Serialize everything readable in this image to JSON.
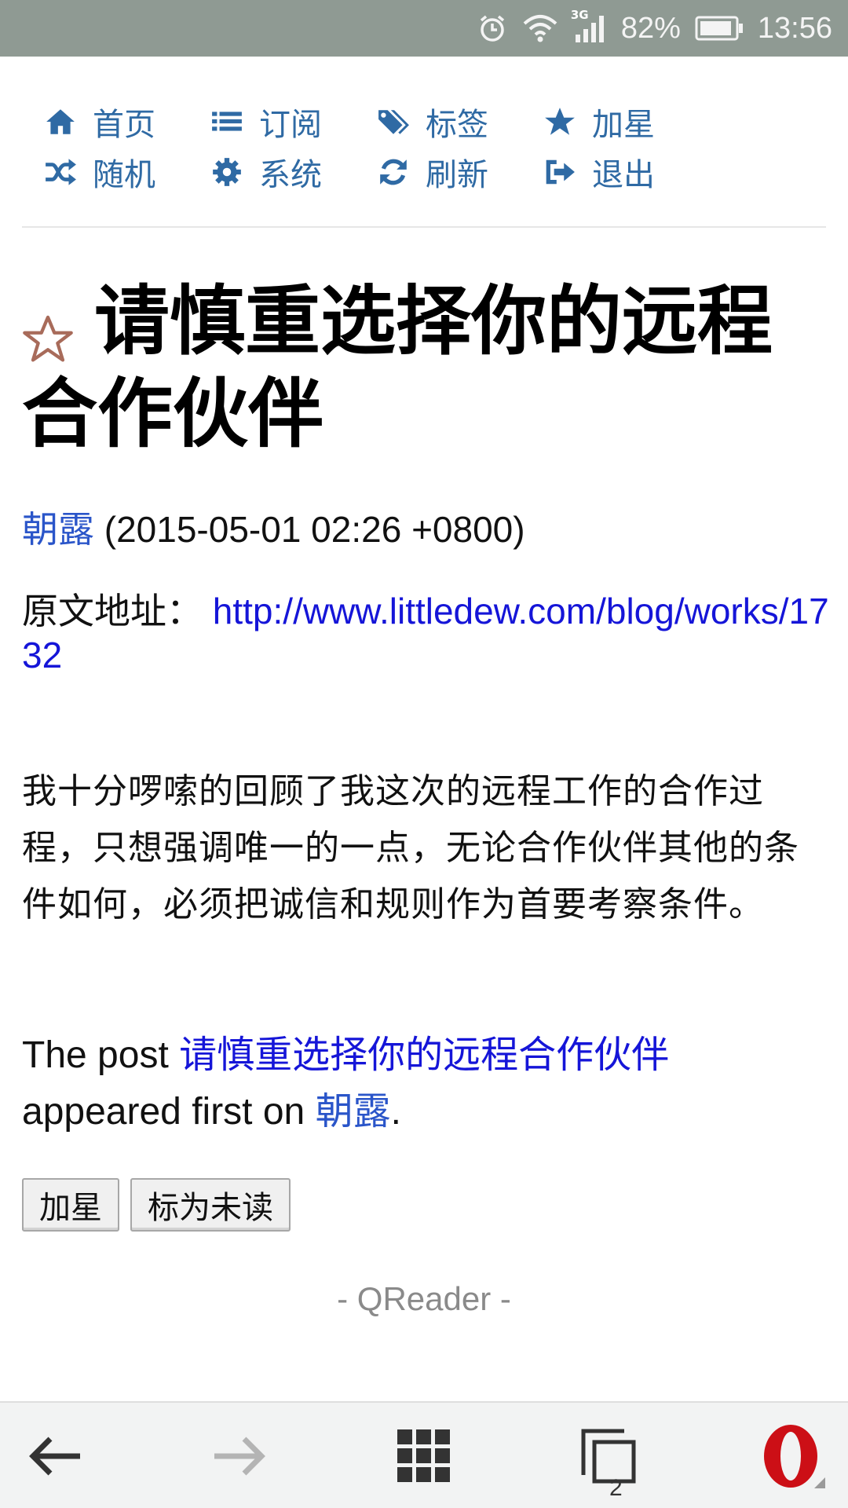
{
  "status_bar": {
    "network_label": "3G",
    "battery": "82%",
    "time": "13:56"
  },
  "nav": {
    "items": [
      {
        "label": "首页",
        "icon": "home-icon"
      },
      {
        "label": "订阅",
        "icon": "list-icon"
      },
      {
        "label": "标签",
        "icon": "tags-icon"
      },
      {
        "label": "加星",
        "icon": "star-icon"
      },
      {
        "label": "随机",
        "icon": "shuffle-icon"
      },
      {
        "label": "系统",
        "icon": "gear-icon"
      },
      {
        "label": "刷新",
        "icon": "refresh-icon"
      },
      {
        "label": "退出",
        "icon": "sign-out-icon"
      }
    ]
  },
  "article": {
    "title": "请慎重选择你的远程合作伙伴",
    "author": "朝露",
    "date": "(2015-05-01 02:26 +0800)",
    "source_label": "原文地址：",
    "source_url": "http://www.littledew.com/blog/works/1732",
    "body": "我十分啰嗦的回顾了我这次的远程工作的合作过程，只想强调唯一的一点，无论合作伙伴其他的条件如何，必须把诚信和规则作为首要考察条件。",
    "footer_prefix": "The post ",
    "footer_link": "请慎重选择你的远程合作伙伴",
    "footer_middle": " appeared first on ",
    "footer_site": "朝露",
    "footer_end": "."
  },
  "actions": {
    "star_label": "加星",
    "mark_unread_label": "标为未读"
  },
  "brand": "- QReader -",
  "browser_bar": {
    "tab_count": "2"
  },
  "colors": {
    "nav_blue": "#2f6aa4",
    "link_blue": "#1515d8",
    "status_bar": "#8f9a93",
    "opera_red": "#cc0f16"
  }
}
